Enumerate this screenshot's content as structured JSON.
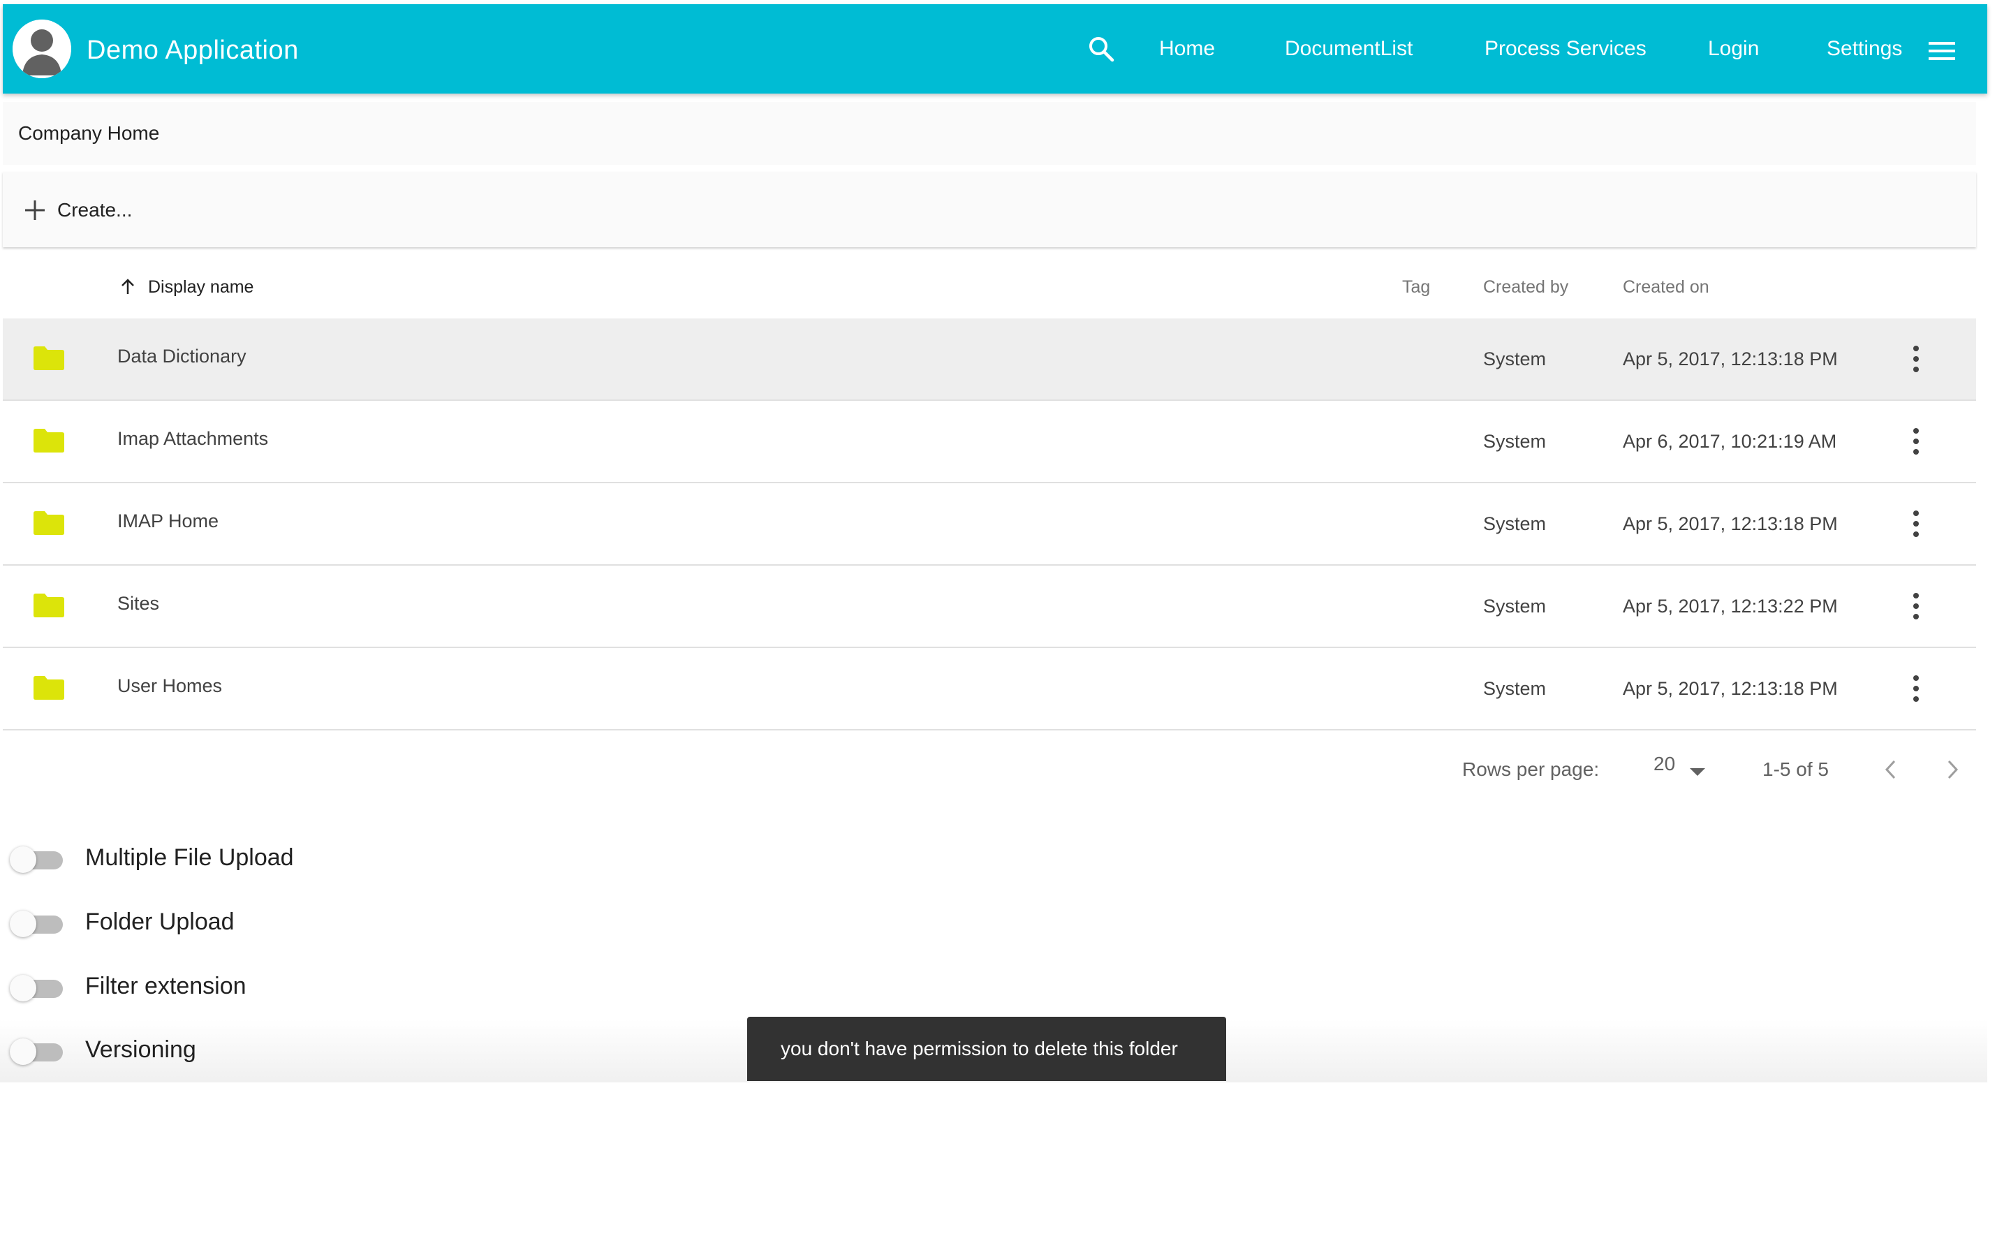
{
  "header": {
    "title": "Demo Application",
    "nav": [
      {
        "label": "Home"
      },
      {
        "label": "DocumentList"
      },
      {
        "label": "Process Services"
      },
      {
        "label": "Login"
      },
      {
        "label": "Settings"
      }
    ],
    "icons": {
      "search": "search-icon",
      "menu": "hamburger-menu-icon",
      "avatar": "user-avatar-icon"
    }
  },
  "breadcrumb": {
    "current": "Company Home"
  },
  "toolbar": {
    "create_label": "Create..."
  },
  "table": {
    "columns": {
      "display_name": "Display name",
      "tag": "Tag",
      "created_by": "Created by",
      "created_on": "Created on"
    },
    "sort": {
      "column": "display_name",
      "direction": "ascending"
    },
    "rows": [
      {
        "name": "Data Dictionary",
        "created_by": "System",
        "created_on": "Apr 5, 2017, 12:13:18 PM",
        "selected": true
      },
      {
        "name": "Imap Attachments",
        "created_by": "System",
        "created_on": "Apr 6, 2017, 10:21:19 AM",
        "selected": false
      },
      {
        "name": "IMAP Home",
        "created_by": "System",
        "created_on": "Apr 5, 2017, 12:13:18 PM",
        "selected": false
      },
      {
        "name": "Sites",
        "created_by": "System",
        "created_on": "Apr 5, 2017, 12:13:22 PM",
        "selected": false
      },
      {
        "name": "User Homes",
        "created_by": "System",
        "created_on": "Apr 5, 2017, 12:13:18 PM",
        "selected": false
      }
    ]
  },
  "pagination": {
    "rows_per_page_label": "Rows per page:",
    "rows_per_page": "20",
    "range": "1-5 of 5"
  },
  "toggles": [
    {
      "label": "Multiple File Upload",
      "on": false
    },
    {
      "label": "Folder Upload",
      "on": false
    },
    {
      "label": "Filter extension",
      "on": false
    },
    {
      "label": "Versioning",
      "on": false
    }
  ],
  "snackbar": {
    "message": "you don't have permission to delete this folder"
  },
  "colors": {
    "header_bg": "#00bcd4",
    "folder": "#dce40a",
    "snackbar_bg": "#323232",
    "selected_row": "#eeeeee"
  }
}
